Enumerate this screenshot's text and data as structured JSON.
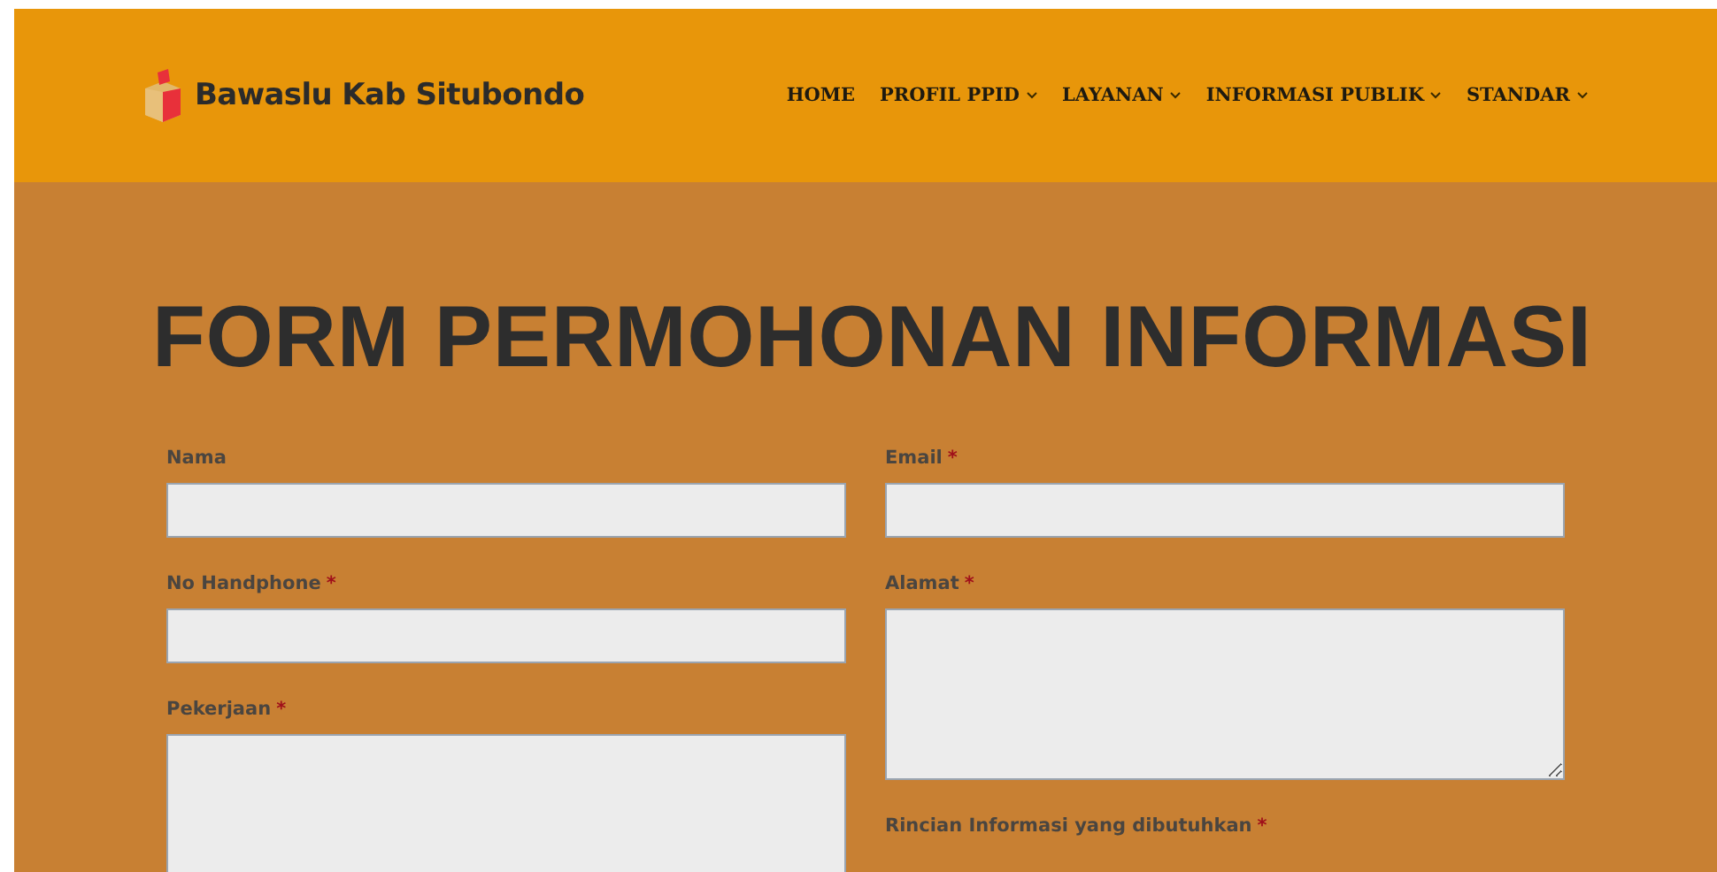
{
  "header": {
    "site_name": "Bawaslu Kab Situbondo",
    "nav": [
      {
        "label": "HOME",
        "has_dropdown": false
      },
      {
        "label": "PROFIL PPID",
        "has_dropdown": true
      },
      {
        "label": "LAYANAN",
        "has_dropdown": true
      },
      {
        "label": "INFORMASI PUBLIK",
        "has_dropdown": true
      },
      {
        "label": "STANDAR",
        "has_dropdown": true
      }
    ]
  },
  "title": "FORM PERMOHONAN INFORMASI",
  "form": {
    "columns": [
      [
        {
          "label": "Nama",
          "kind": "input"
        },
        {
          "label": "No Handphone",
          "required_mark": "*",
          "kind": "input"
        },
        {
          "label": "Pekerjaan",
          "required_mark": "*",
          "kind": "textarea"
        }
      ],
      [
        {
          "label": "Email",
          "required_mark": "*",
          "kind": "input"
        },
        {
          "label": "Alamat",
          "required_mark": "*",
          "kind": "textarea"
        },
        {
          "label": "Rincian Informasi yang dibutuhkan",
          "required_mark": "*",
          "kind": "label"
        }
      ]
    ]
  }
}
